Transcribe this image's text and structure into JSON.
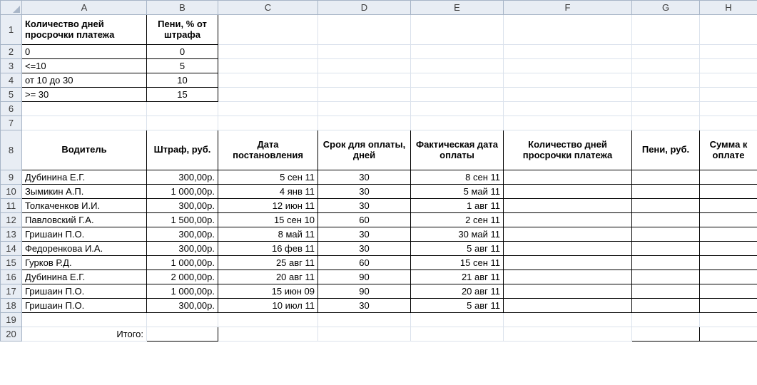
{
  "columns": [
    "A",
    "B",
    "C",
    "D",
    "E",
    "F",
    "G",
    "H"
  ],
  "rules": {
    "hdr_days": "Количество дней просрочки платежа",
    "hdr_pct": "Пени, % от штрафа",
    "rows": [
      {
        "days": "0",
        "pct": "0"
      },
      {
        "days": "<=10",
        "pct": "5"
      },
      {
        "days": "от 10 до 30",
        "pct": "10"
      },
      {
        "days": ">= 30",
        "pct": "15"
      }
    ]
  },
  "table": {
    "headers": {
      "driver": "Водитель",
      "fine": "Штраф, руб.",
      "date_res": "Дата постановления",
      "pay_days": "Срок для оплаты, дней",
      "fact_date": "Фактическая дата оплаты",
      "overdue": "Количество дней просрочки платежа",
      "penalty": "Пени, руб.",
      "total": "Сумма к оплате"
    },
    "rows": [
      {
        "driver": "Дубинина Е.Г.",
        "fine": "300,00р.",
        "date_res": "5 сен 11",
        "pay_days": "30",
        "fact_date": "8 сен 11"
      },
      {
        "driver": "Зымикин А.П.",
        "fine": "1 000,00р.",
        "date_res": "4 янв 11",
        "pay_days": "30",
        "fact_date": "5 май 11"
      },
      {
        "driver": "Толкаченков И.И.",
        "fine": "300,00р.",
        "date_res": "12 июн 11",
        "pay_days": "30",
        "fact_date": "1 авг 11"
      },
      {
        "driver": "Павловский Г.А.",
        "fine": "1 500,00р.",
        "date_res": "15 сен 10",
        "pay_days": "60",
        "fact_date": "2 сен 11"
      },
      {
        "driver": "Гришаин П.О.",
        "fine": "300,00р.",
        "date_res": "8 май 11",
        "pay_days": "30",
        "fact_date": "30 май 11"
      },
      {
        "driver": "Федоренкова И.А.",
        "fine": "300,00р.",
        "date_res": "16 фев 11",
        "pay_days": "30",
        "fact_date": "5 авг 11"
      },
      {
        "driver": "Гурков Р.Д.",
        "fine": "1 000,00р.",
        "date_res": "25 авг 11",
        "pay_days": "60",
        "fact_date": "15 сен 11"
      },
      {
        "driver": "Дубинина Е.Г.",
        "fine": "2 000,00р.",
        "date_res": "20 авг 11",
        "pay_days": "90",
        "fact_date": "21 авг 11"
      },
      {
        "driver": "Гришаин П.О.",
        "fine": "1 000,00р.",
        "date_res": "15 июн 09",
        "pay_days": "90",
        "fact_date": "20 авг 11"
      },
      {
        "driver": "Гришаин П.О.",
        "fine": "300,00р.",
        "date_res": "10 июл 11",
        "pay_days": "30",
        "fact_date": "5 авг 11"
      }
    ],
    "total_label": "Итого:"
  },
  "chart_data": {
    "type": "table",
    "rules": [
      {
        "days_overdue": "0",
        "penalty_pct": 0
      },
      {
        "days_overdue": "<=10",
        "penalty_pct": 5
      },
      {
        "days_overdue": "от 10 до 30",
        "penalty_pct": 10
      },
      {
        "days_overdue": ">= 30",
        "penalty_pct": 15
      }
    ],
    "records": [
      {
        "driver": "Дубинина Е.Г.",
        "fine_rub": 300,
        "resolution_date": "5 сен 11",
        "pay_term_days": 30,
        "actual_pay_date": "8 сен 11"
      },
      {
        "driver": "Зымикин А.П.",
        "fine_rub": 1000,
        "resolution_date": "4 янв 11",
        "pay_term_days": 30,
        "actual_pay_date": "5 май 11"
      },
      {
        "driver": "Толкаченков И.И.",
        "fine_rub": 300,
        "resolution_date": "12 июн 11",
        "pay_term_days": 30,
        "actual_pay_date": "1 авг 11"
      },
      {
        "driver": "Павловский Г.А.",
        "fine_rub": 1500,
        "resolution_date": "15 сен 10",
        "pay_term_days": 60,
        "actual_pay_date": "2 сен 11"
      },
      {
        "driver": "Гришаин П.О.",
        "fine_rub": 300,
        "resolution_date": "8 май 11",
        "pay_term_days": 30,
        "actual_pay_date": "30 май 11"
      },
      {
        "driver": "Федоренкова И.А.",
        "fine_rub": 300,
        "resolution_date": "16 фев 11",
        "pay_term_days": 30,
        "actual_pay_date": "5 авг 11"
      },
      {
        "driver": "Гурков Р.Д.",
        "fine_rub": 1000,
        "resolution_date": "25 авг 11",
        "pay_term_days": 60,
        "actual_pay_date": "15 сен 11"
      },
      {
        "driver": "Дубинина Е.Г.",
        "fine_rub": 2000,
        "resolution_date": "20 авг 11",
        "pay_term_days": 90,
        "actual_pay_date": "21 авг 11"
      },
      {
        "driver": "Гришаин П.О.",
        "fine_rub": 1000,
        "resolution_date": "15 июн 09",
        "pay_term_days": 90,
        "actual_pay_date": "20 авг 11"
      },
      {
        "driver": "Гришаин П.О.",
        "fine_rub": 300,
        "resolution_date": "10 июл 11",
        "pay_term_days": 30,
        "actual_pay_date": "5 авг 11"
      }
    ]
  }
}
